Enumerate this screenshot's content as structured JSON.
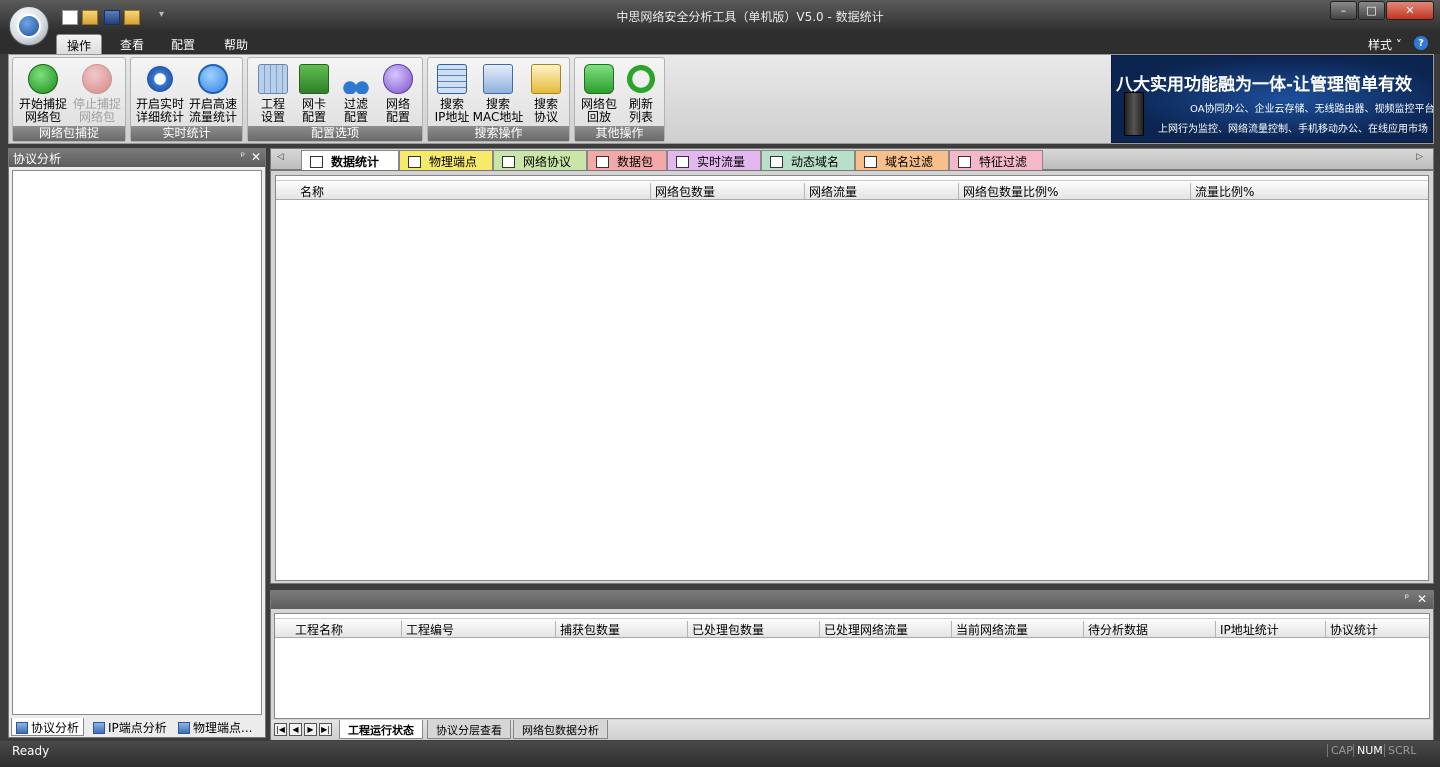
{
  "window": {
    "title": "中思网络安全分析工具（单机版）V5.0 - 数据统计",
    "minimize": "–",
    "maximize": "□",
    "close": "✕"
  },
  "quick_access": {
    "dropdown": "▾"
  },
  "menu_tabs": [
    {
      "label": "操作",
      "active": true
    },
    {
      "label": "查看",
      "active": false
    },
    {
      "label": "配置",
      "active": false
    },
    {
      "label": "帮助",
      "active": false
    }
  ],
  "style_menu": {
    "label": "样式",
    "arrow": "˅",
    "help": "?"
  },
  "ribbon": {
    "groups": [
      {
        "label": "网络包捕捉",
        "buttons": [
          {
            "line1": "开始捕捉",
            "line2": "网络包",
            "icon": "play-icon",
            "enabled": true
          },
          {
            "line1": "停止捕捉",
            "line2": "网络包",
            "icon": "stop-icon",
            "enabled": false
          }
        ]
      },
      {
        "label": "实时统计",
        "buttons": [
          {
            "line1": "开启实时",
            "line2": "详细统计",
            "icon": "realtime-icon",
            "enabled": true
          },
          {
            "line1": "开启高速",
            "line2": "流量统计",
            "icon": "magnifier-icon",
            "enabled": true
          }
        ]
      },
      {
        "label": "配置选项",
        "buttons": [
          {
            "line1": "工程",
            "line2": "设置",
            "icon": "project-settings-icon",
            "enabled": true
          },
          {
            "line1": "网卡",
            "line2": "配置",
            "icon": "network-card-icon",
            "enabled": true
          },
          {
            "line1": "过滤",
            "line2": "配置",
            "icon": "scissors-icon",
            "enabled": true
          },
          {
            "line1": "网络",
            "line2": "配置",
            "icon": "network-globe-icon",
            "enabled": true
          }
        ]
      },
      {
        "label": "搜索操作",
        "buttons": [
          {
            "line1": "搜索",
            "line2": "IP地址",
            "icon": "search-ip-icon",
            "enabled": true
          },
          {
            "line1": "搜索",
            "line2": "MAC地址",
            "icon": "search-mac-icon",
            "enabled": true
          },
          {
            "line1": "搜索",
            "line2": "协议",
            "icon": "search-protocol-icon",
            "enabled": true
          }
        ]
      },
      {
        "label": "其他操作",
        "buttons": [
          {
            "line1": "网络包",
            "line2": "回放",
            "icon": "camera-icon",
            "enabled": true
          },
          {
            "line1": "刷新",
            "line2": "列表",
            "icon": "refresh-icon",
            "enabled": true
          }
        ]
      }
    ],
    "banner": {
      "title": "八大实用功能融为一体-让管理简单有效",
      "line1": "OA协同办公、企业云存储、无线路由器、视频监控平台",
      "line2": "上网行为监控、网络流量控制、手机移动办公、在线应用市场"
    }
  },
  "left_panel": {
    "title": "协议分析",
    "pin": "ᵖ",
    "close": "✕",
    "tabs": [
      {
        "label": "协议分析",
        "active": true
      },
      {
        "label": "IP端点分析",
        "active": false
      },
      {
        "label": "物理端点...",
        "active": false
      }
    ]
  },
  "doc_tabs": {
    "left_arrow": "◁",
    "right_arrow": "▷",
    "items": [
      {
        "label": "数据统计",
        "active": true,
        "color": "#ffffff"
      },
      {
        "label": "物理端点",
        "active": false,
        "color": "#f7e96a"
      },
      {
        "label": "网络协议",
        "active": false,
        "color": "#c9e6a8"
      },
      {
        "label": "数据包",
        "active": false,
        "color": "#f4a9a9"
      },
      {
        "label": "实时流量",
        "active": false,
        "color": "#e3b8f0"
      },
      {
        "label": "动态域名",
        "active": false,
        "color": "#b8e0c8"
      },
      {
        "label": "域名过滤",
        "active": false,
        "color": "#f7c08a"
      },
      {
        "label": "特征过滤",
        "active": false,
        "color": "#f4b8c9"
      }
    ]
  },
  "main_grid": {
    "columns": [
      "名称",
      "网络包数量",
      "网络流量",
      "网络包数量比例%",
      "流量比例%"
    ]
  },
  "bottom_panel": {
    "pin": "ᵖ",
    "close": "✕",
    "columns": [
      "工程名称",
      "工程编号",
      "捕获包数量",
      "已处理包数量",
      "已处理网络流量",
      "当前网络流量",
      "待分析数据",
      "IP地址统计",
      "协议统计"
    ],
    "nav": [
      "|◀",
      "◀",
      "▶",
      "▶|"
    ],
    "tabs": [
      {
        "label": "工程运行状态",
        "active": true
      },
      {
        "label": "协议分层查看",
        "active": false
      },
      {
        "label": "网络包数据分析",
        "active": false
      }
    ]
  },
  "statusbar": {
    "text": "Ready",
    "indicators": [
      {
        "label": "CAP",
        "on": false
      },
      {
        "label": "NUM",
        "on": true
      },
      {
        "label": "SCRL",
        "on": false
      }
    ]
  }
}
